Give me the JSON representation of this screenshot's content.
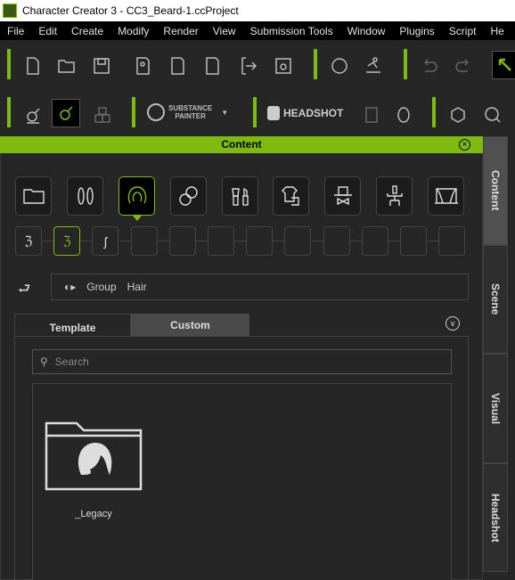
{
  "window": {
    "title": "Character Creator 3 - CC3_Beard-1.ccProject"
  },
  "menu": [
    "File",
    "Edit",
    "Create",
    "Modify",
    "Render",
    "View",
    "Submission Tools",
    "Window",
    "Plugins",
    "Script",
    "He"
  ],
  "toolbar2": {
    "substance_line1": "SUBSTANCE",
    "substance_line2": "PAINTER",
    "headshot": "HEADSHOT"
  },
  "panel": {
    "title": "Content",
    "accent": "#7fba0f"
  },
  "side_tabs": [
    "Content",
    "Scene",
    "Visual",
    "Headshot"
  ],
  "categories": [
    "folder-icon",
    "body-icon",
    "hair-icon",
    "skin-icon",
    "makeup-icon",
    "cloth-icon",
    "accessory-icon",
    "motion-icon",
    "stage-icon"
  ],
  "selected_category": "hair-icon",
  "breadcrumb": [
    "Group",
    "Hair"
  ],
  "tabs": {
    "template": "Template",
    "custom": "Custom",
    "active": "Custom"
  },
  "search": {
    "placeholder": "Search"
  },
  "items": [
    {
      "label": "_Legacy"
    }
  ]
}
